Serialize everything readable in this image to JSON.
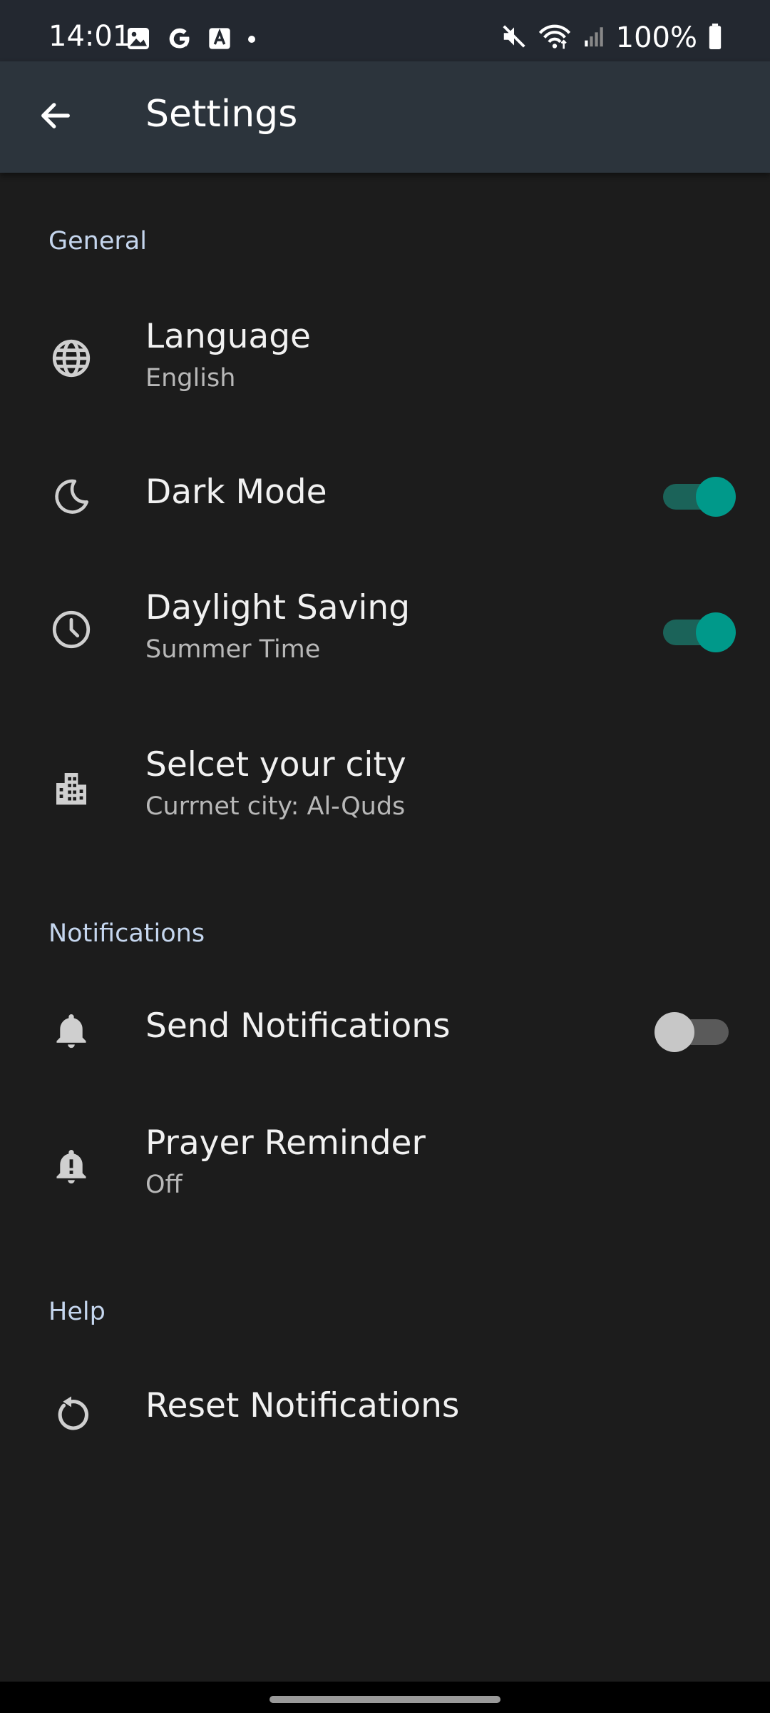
{
  "status_bar": {
    "time": "14:01",
    "battery_text": "100%",
    "left_icons": [
      "gallery-icon",
      "google-icon",
      "text-icon",
      "dot-icon"
    ],
    "right_icons": [
      "mute-icon",
      "wifi-icon",
      "signal-icon",
      "battery-icon"
    ]
  },
  "app_bar": {
    "title": "Settings",
    "back_icon": "arrow-back-icon"
  },
  "sections": {
    "general": {
      "header": "General",
      "language": {
        "title": "Language",
        "subtitle": "English",
        "icon": "globe-icon"
      },
      "dark_mode": {
        "title": "Dark Mode",
        "icon": "moon-icon",
        "enabled": true
      },
      "daylight_saving": {
        "title": "Daylight Saving",
        "subtitle": "Summer Time",
        "icon": "clock-icon",
        "enabled": true
      },
      "city": {
        "title": "Selcet your city",
        "subtitle": "Currnet city: Al-Quds",
        "icon": "city-icon"
      }
    },
    "notifications": {
      "header": "Notifications",
      "send_notifications": {
        "title": "Send Notifications",
        "icon": "bell-icon",
        "enabled": false
      },
      "prayer_reminder": {
        "title": "Prayer Reminder",
        "subtitle": "Off",
        "icon": "bell-alert-icon"
      }
    },
    "help": {
      "header": "Help",
      "reset_notifications": {
        "title": "Reset Notifications",
        "icon": "reset-icon"
      }
    }
  },
  "colors": {
    "background": "#1c1c1c",
    "app_bar": "#2c343c",
    "status_bar": "#232830",
    "accent": "#00998a",
    "section_header": "#c5d6ee"
  }
}
